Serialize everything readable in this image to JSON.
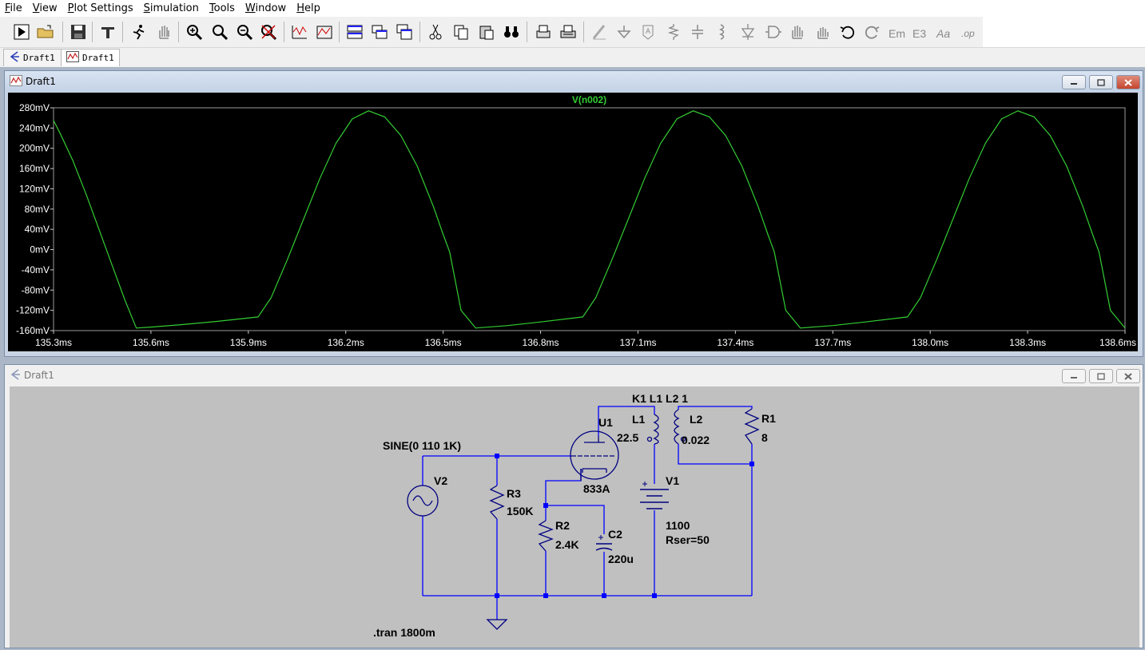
{
  "menu": [
    "File",
    "View",
    "Plot Settings",
    "Simulation",
    "Tools",
    "Window",
    "Help"
  ],
  "tabs": [
    {
      "label": "Draft1",
      "icon": "schematic-icon"
    },
    {
      "label": "Draft1",
      "icon": "waveform-icon"
    }
  ],
  "plot_window": {
    "title": "Draft1"
  },
  "schematic_window": {
    "title": "Draft1"
  },
  "chart_data": {
    "type": "line",
    "title": "V(n002)",
    "xlabel": "",
    "ylabel": "",
    "xlim": [
      135.3,
      138.6
    ],
    "ylim": [
      -160,
      280
    ],
    "x_ticks": [
      "135.3ms",
      "135.6ms",
      "135.9ms",
      "136.2ms",
      "136.5ms",
      "136.8ms",
      "137.1ms",
      "137.4ms",
      "137.7ms",
      "138.0ms",
      "138.3ms",
      "138.6ms"
    ],
    "y_ticks": [
      "280mV",
      "240mV",
      "200mV",
      "160mV",
      "120mV",
      "80mV",
      "40mV",
      "0mV",
      "-40mV",
      "-80mV",
      "-120mV",
      "-160mV"
    ],
    "series": [
      {
        "name": "V(n002)",
        "color": "#33cc33",
        "x": [
          135.3,
          135.32,
          135.36,
          135.4,
          135.44,
          135.48,
          135.52,
          135.555,
          135.6,
          135.7,
          135.8,
          135.93,
          135.97,
          136.02,
          136.07,
          136.12,
          136.17,
          136.22,
          136.27,
          136.32,
          136.37,
          136.42,
          136.47,
          136.5,
          136.52,
          136.555,
          136.6,
          136.7,
          136.8,
          136.93,
          136.97,
          137.02,
          137.07,
          137.12,
          137.17,
          137.22,
          137.27,
          137.32,
          137.37,
          137.42,
          137.47,
          137.5,
          137.52,
          137.555,
          137.6,
          137.7,
          137.8,
          137.93,
          137.97,
          138.02,
          138.07,
          138.12,
          138.17,
          138.22,
          138.27,
          138.32,
          138.37,
          138.42,
          138.47,
          138.5,
          138.52,
          138.555,
          138.6
        ],
        "y": [
          255,
          230,
          175,
          110,
          40,
          -30,
          -100,
          -155,
          -153,
          -148,
          -142,
          -133,
          -95,
          -20,
          60,
          140,
          210,
          258,
          274,
          262,
          225,
          165,
          85,
          30,
          -5,
          -120,
          -155,
          -150,
          -143,
          -133,
          -95,
          -20,
          60,
          140,
          210,
          258,
          274,
          262,
          225,
          165,
          85,
          30,
          -5,
          -120,
          -155,
          -150,
          -143,
          -133,
          -95,
          -20,
          60,
          140,
          210,
          258,
          274,
          262,
          225,
          165,
          85,
          30,
          -5,
          -120,
          -155
        ]
      }
    ]
  },
  "schematic": {
    "labels": {
      "sine": "SINE(0 110 1K)",
      "v2": "V2",
      "r3": "R3",
      "r3_val": "150K",
      "u1": "U1",
      "u1_val": "833A",
      "r2": "R2",
      "r2_val": "2.4K",
      "c2": "C2",
      "c2_val": "220u",
      "k1": "K1 L1 L2 1",
      "l1": "L1",
      "l1_val": "22.5",
      "l2": "L2",
      "l2_val": "0.022",
      "r1": "R1",
      "r1_val": "8",
      "v1": "V1",
      "v1_val": "1100",
      "v1_rser": "Rser=50",
      "tran": ".tran 1800m"
    },
    "wire_color": "#0000ff"
  }
}
